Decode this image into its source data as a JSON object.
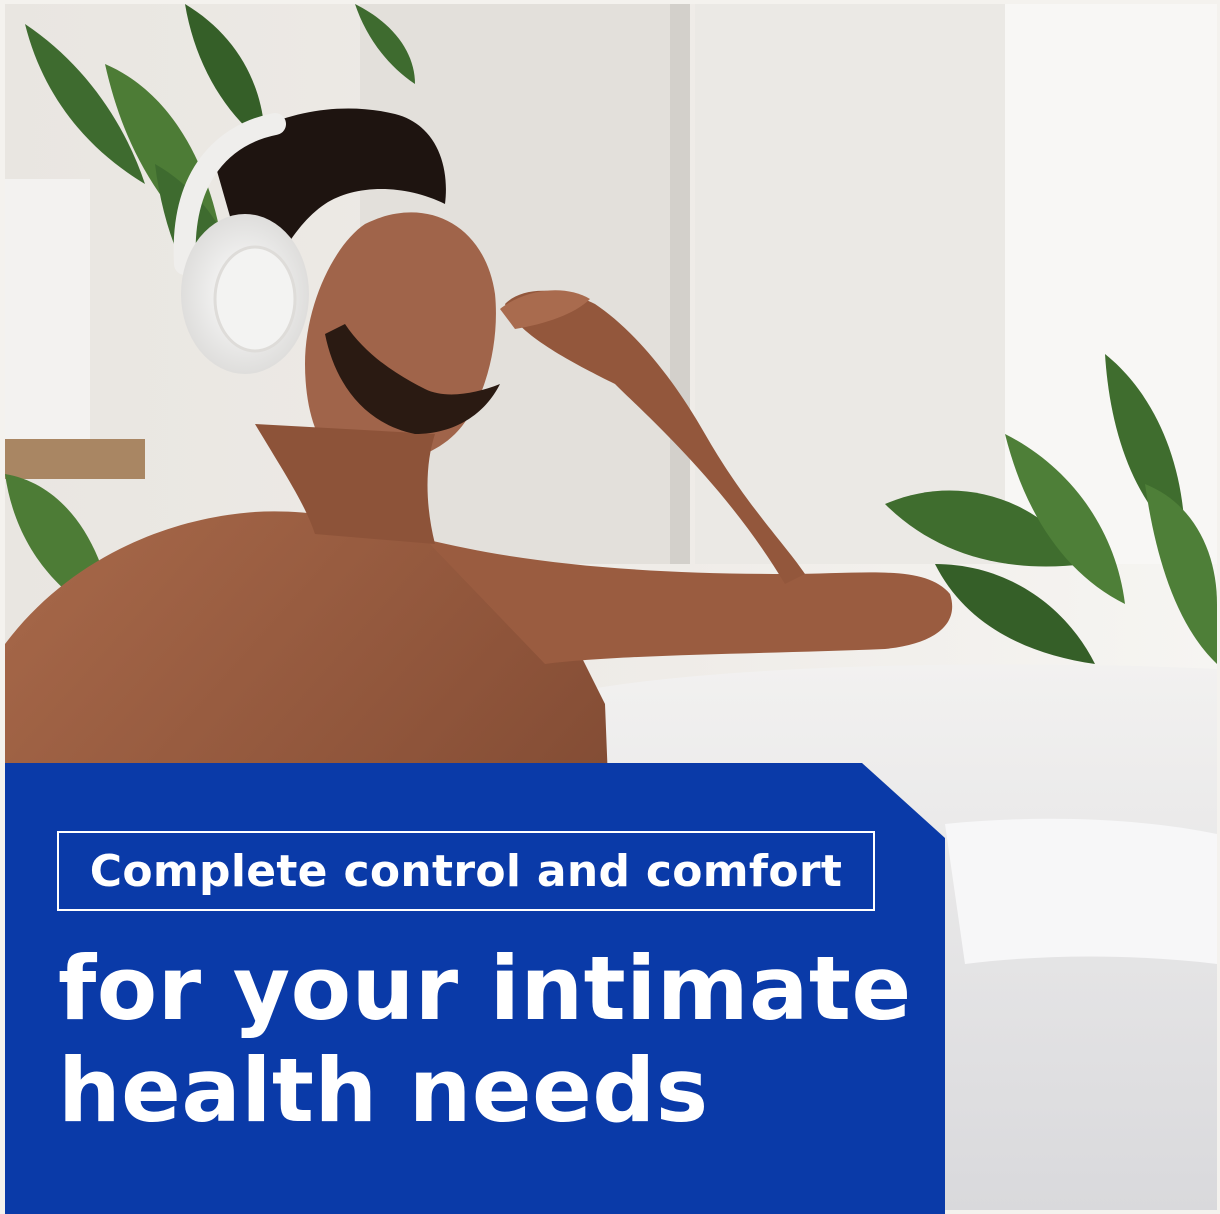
{
  "banner": {
    "headline": "Complete control and comfort",
    "subhead_line1": "for your intimate",
    "subhead_line2": "health needs"
  },
  "colors": {
    "panel_blue": "#0a3aa8",
    "text": "#ffffff"
  }
}
